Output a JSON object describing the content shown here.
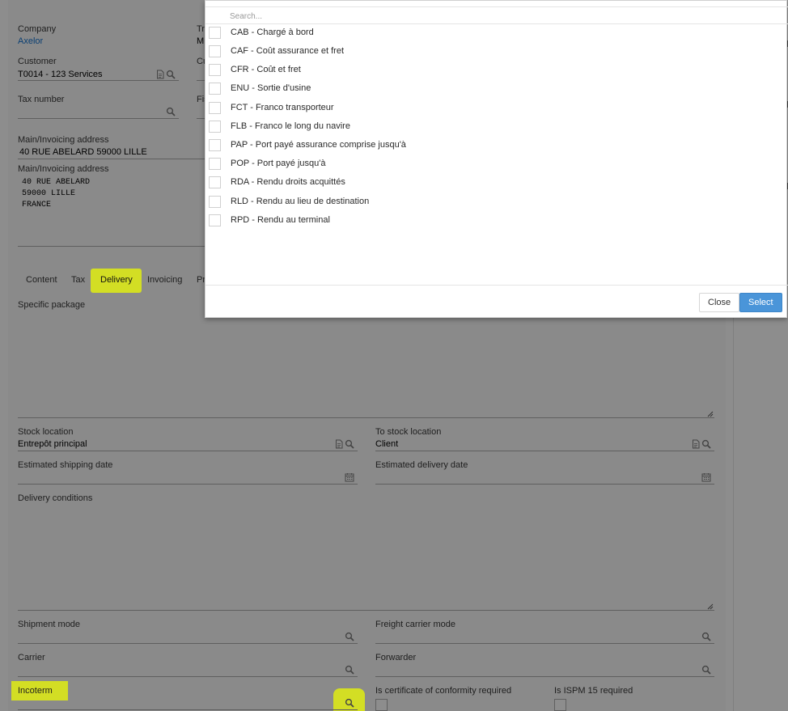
{
  "form": {
    "company_label": "Company",
    "company_value": "Axelor",
    "trading_label_partial": "Tr",
    "trading_value_partial": "M",
    "customer_label": "Customer",
    "customer_value": "T0014 - 123 Services",
    "contact_label_partial": "Cu",
    "tax_number_label": "Tax number",
    "fiscal_label_partial": "Fis",
    "main_address_label_1": "Main/Invoicing address",
    "main_address_value": "40 RUE ABELARD 59000 LILLE",
    "main_address_label_2": "Main/Invoicing address",
    "address_lines": [
      "40 RUE ABELARD",
      "59000 LILLE",
      "FRANCE"
    ]
  },
  "tabs": [
    "Content",
    "Tax",
    "Delivery",
    "Invoicing",
    "Pr"
  ],
  "delivery": {
    "specific_package_label": "Specific package",
    "stock_location_label": "Stock location",
    "stock_location_value": "Entrepôt principal",
    "to_stock_location_label": "To stock location",
    "to_stock_location_value": "Client",
    "est_shipping_label": "Estimated shipping date",
    "est_delivery_label": "Estimated delivery date",
    "delivery_conditions_label": "Delivery conditions",
    "shipment_mode_label": "Shipment mode",
    "freight_carrier_label": "Freight carrier mode",
    "carrier_label": "Carrier",
    "forwarder_label": "Forwarder",
    "incoterm_label": "Incoterm",
    "certificate_label": "Is certificate of conformity required",
    "ispm_label": "Is ISPM 15 required"
  },
  "dialog": {
    "search_placeholder": "Search...",
    "items": [
      "CAB - Chargé à bord",
      "CAF - Coût assurance et fret",
      "CFR - Coût et fret",
      "ENU - Sortie d'usine",
      "FCT - Franco transporteur",
      "FLB - Franco le long du navire",
      "PAP - Port payé assurance comprise jusqu'à",
      "POP - Port payé jusqu'à",
      "RDA - Rendu droits acquittés",
      "RLD - Rendu au lieu de destination",
      "RPD - Rendu au terminal"
    ],
    "close_label": "Close",
    "select_label": "Select"
  },
  "colors": {
    "highlight": "#d3de24",
    "select_button": "#4a95d9",
    "link": "#0a3f73"
  }
}
